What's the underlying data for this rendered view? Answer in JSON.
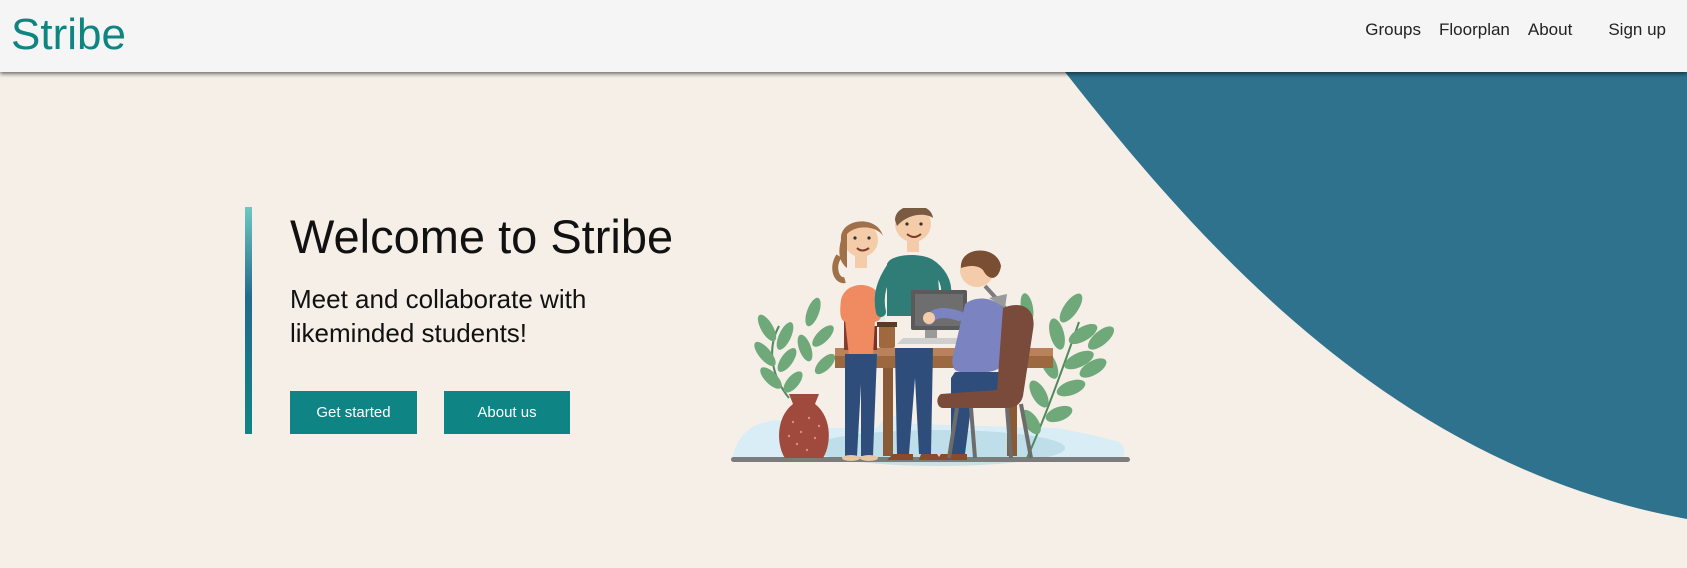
{
  "nav": {
    "brand": "Stribe",
    "links": [
      "Groups",
      "Floorplan",
      "About"
    ],
    "signup": "Sign up"
  },
  "hero": {
    "title": "Welcome to Stribe",
    "subtitle": "Meet and collaborate with likeminded students!",
    "primary_button": "Get started",
    "secondary_button": "About us"
  },
  "illustration": {
    "icon": "students-collaborating-illustration"
  },
  "colors": {
    "accent": "#0e8580",
    "wave": "#2e728e",
    "background": "#f5efe8",
    "navbar": "#f5f5f5"
  }
}
